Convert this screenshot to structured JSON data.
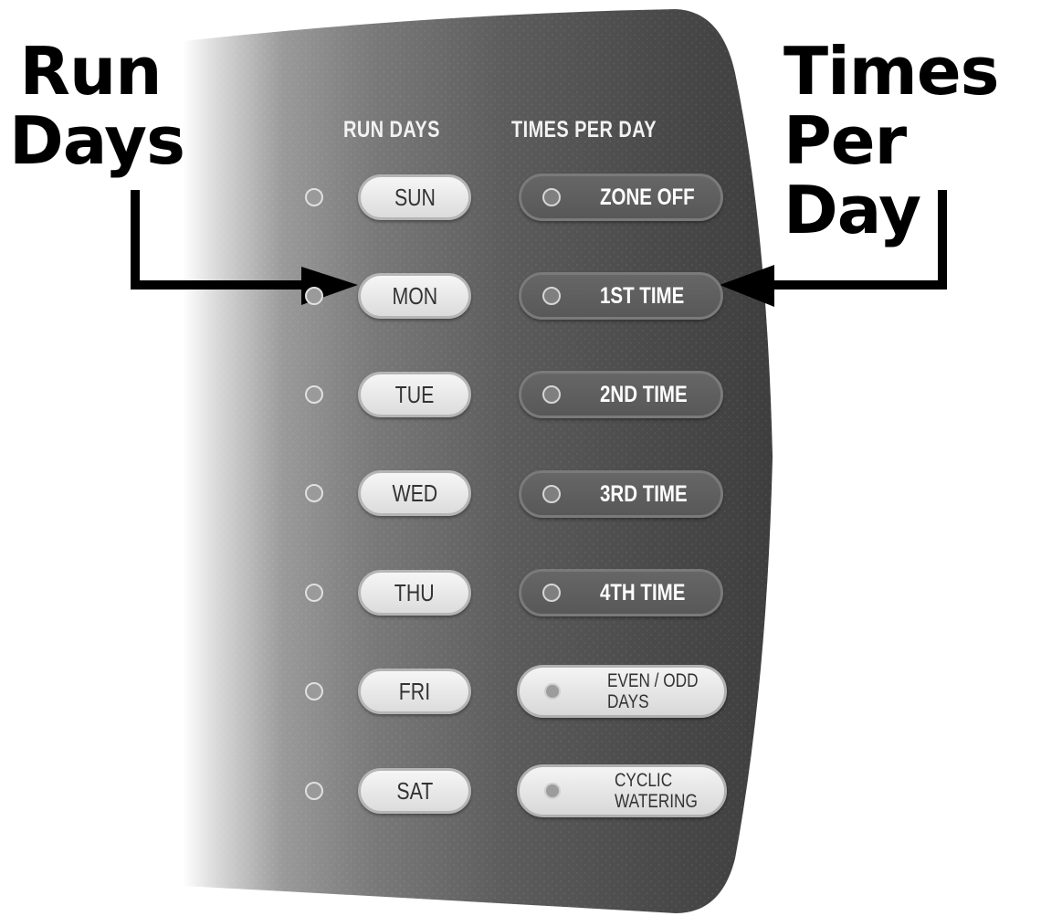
{
  "callouts": {
    "left": [
      "Run",
      "Days"
    ],
    "right": [
      "Times",
      "Per Day"
    ]
  },
  "headers": {
    "run_days": "RUN DAYS",
    "times_per_day": "TIMES PER DAY"
  },
  "run_days": [
    {
      "label": "SUN"
    },
    {
      "label": "MON"
    },
    {
      "label": "TUE"
    },
    {
      "label": "WED"
    },
    {
      "label": "THU"
    },
    {
      "label": "FRI"
    },
    {
      "label": "SAT"
    }
  ],
  "times_per_day": [
    {
      "label": "ZONE OFF",
      "style": "dark"
    },
    {
      "label": "1ST TIME",
      "style": "dark"
    },
    {
      "label": "2ND TIME",
      "style": "dark"
    },
    {
      "label": "3RD TIME",
      "style": "dark"
    },
    {
      "label": "4TH TIME",
      "style": "dark"
    },
    {
      "line1": "EVEN / ODD",
      "line2": "DAYS",
      "style": "light"
    },
    {
      "line1": "CYCLIC",
      "line2": "WATERING",
      "style": "light"
    }
  ],
  "colors": {
    "panel_dark": "#4a4a4a",
    "panel_light": "#ffffff",
    "arrow": "#000000"
  }
}
